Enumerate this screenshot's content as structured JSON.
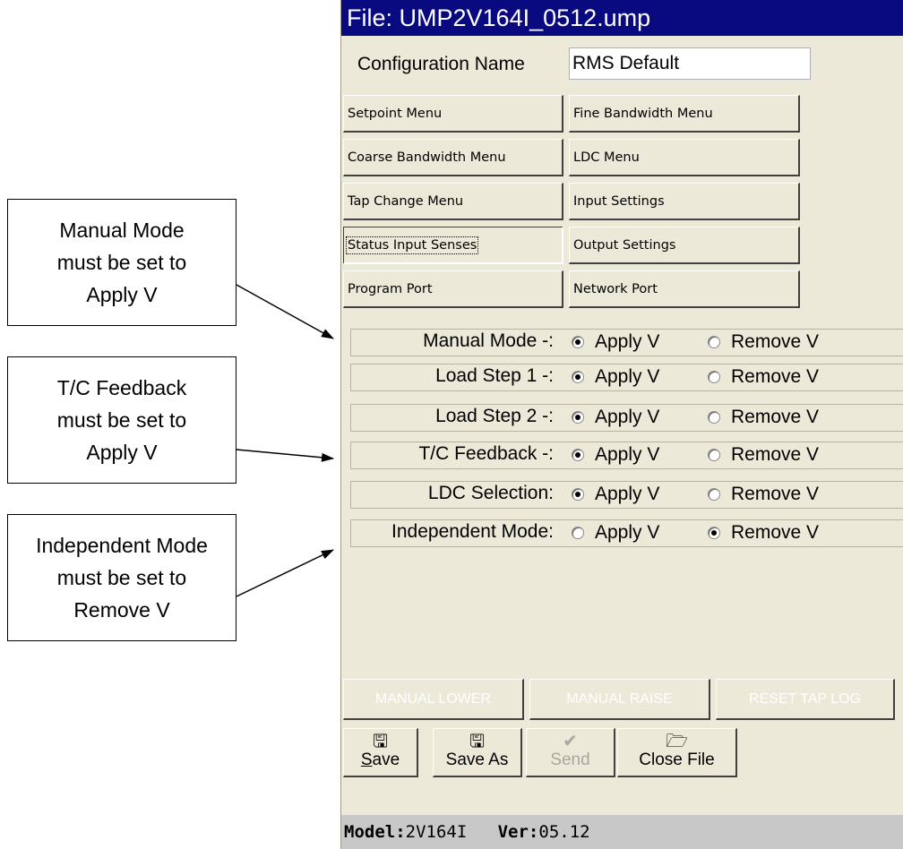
{
  "callouts": [
    {
      "lines": [
        "Manual Mode",
        "must be set to",
        "Apply V"
      ]
    },
    {
      "lines": [
        "T/C Feedback",
        "must be set to",
        "Apply V"
      ]
    },
    {
      "lines": [
        "Independent",
        "Mode",
        "must be set to",
        "Remove V"
      ]
    }
  ],
  "window": {
    "title": "File: UMP2V164I_0512.ump",
    "config_label": "Configuration Name",
    "config_value": "RMS Default"
  },
  "menu": [
    {
      "left": "Setpoint Menu",
      "right": "Fine Bandwidth Menu"
    },
    {
      "left": "Coarse Bandwidth Menu",
      "right": "LDC Menu"
    },
    {
      "left": "Tap Change Menu",
      "right": "Input Settings"
    },
    {
      "left": "Status Input Senses",
      "right": "Output Settings"
    },
    {
      "left": "Program Port",
      "right": "Network Port"
    }
  ],
  "status_inputs": {
    "rows": [
      {
        "label": "Manual Mode -:",
        "selected": "apply"
      },
      {
        "label": "Load Step 1 -:",
        "selected": "apply"
      },
      {
        "label": "Load Step 2 -:",
        "selected": "apply"
      },
      {
        "label": "T/C Feedback -:",
        "selected": "apply"
      },
      {
        "label": "LDC Selection:",
        "selected": "apply"
      },
      {
        "label": "Independent Mode:",
        "selected": "remove"
      }
    ],
    "apply_label": "Apply V",
    "remove_label": "Remove V"
  },
  "actions": {
    "manual_lower": "MANUAL LOWER",
    "manual_raise": "MANUAL RAISE",
    "reset_tap_log": "RESET TAP LOG"
  },
  "toolbar": {
    "save_key": "S",
    "save_rest": "ave",
    "save_as": "Save As",
    "send": "Send",
    "close_file": "Close File"
  },
  "statusbar": {
    "model_label": "Model:",
    "model_value": "2V164I",
    "ver_label": "Ver:",
    "ver_value": "05.12"
  },
  "icons": {
    "save": "floppy-disk-icon",
    "save_as": "floppy-disk-icon",
    "send": "checkmark-icon",
    "close_file": "folder-open-icon"
  }
}
